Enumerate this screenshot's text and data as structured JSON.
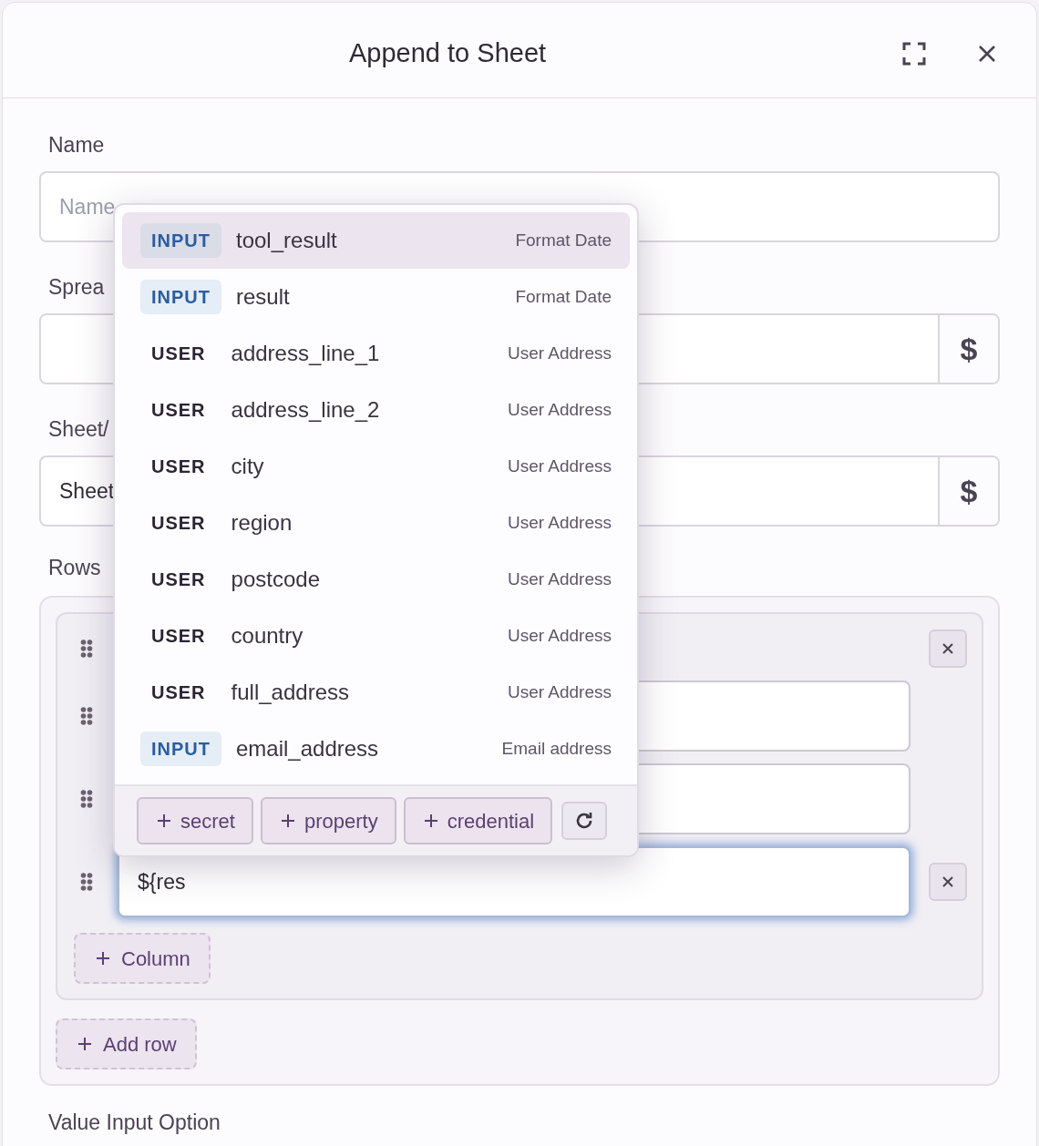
{
  "dialog": {
    "title": "Append to Sheet"
  },
  "fields": [
    {
      "label": "Name",
      "kind": "text",
      "placeholder": "Name"
    },
    {
      "label": "Sprea",
      "kind": "variable",
      "button": "$"
    },
    {
      "label": "Sheet/",
      "kind": "variable",
      "value": "Sheet",
      "button": "$"
    }
  ],
  "rows_section": {
    "label": "Rows",
    "entries": [
      {
        "kind": "header",
        "removable": true
      },
      {
        "kind": "input",
        "removable": false,
        "focused": false
      },
      {
        "kind": "input",
        "removable": false,
        "focused": false
      },
      {
        "kind": "input",
        "value": "${res",
        "removable": true,
        "focused": true
      }
    ],
    "add_column": "Column",
    "add_row": "Add row"
  },
  "next_label": "Value Input Option",
  "suggestions": {
    "items": [
      {
        "kind": "input",
        "tag": "INPUT",
        "name": "tool_result",
        "source": "Format Date",
        "selected": true
      },
      {
        "kind": "input",
        "tag": "INPUT",
        "name": "result",
        "source": "Format Date",
        "selected": false
      },
      {
        "kind": "user",
        "tag": "USER",
        "name": "address_line_1",
        "source": "User Address",
        "selected": false
      },
      {
        "kind": "user",
        "tag": "USER",
        "name": "address_line_2",
        "source": "User Address",
        "selected": false
      },
      {
        "kind": "user",
        "tag": "USER",
        "name": "city",
        "source": "User Address",
        "selected": false
      },
      {
        "kind": "user",
        "tag": "USER",
        "name": "region",
        "source": "User Address",
        "selected": false
      },
      {
        "kind": "user",
        "tag": "USER",
        "name": "postcode",
        "source": "User Address",
        "selected": false
      },
      {
        "kind": "user",
        "tag": "USER",
        "name": "country",
        "source": "User Address",
        "selected": false
      },
      {
        "kind": "user",
        "tag": "USER",
        "name": "full_address",
        "source": "User Address",
        "selected": false
      },
      {
        "kind": "input",
        "tag": "INPUT",
        "name": "email_address",
        "source": "Email address",
        "selected": false
      }
    ],
    "actions": [
      "secret",
      "property",
      "credential"
    ]
  }
}
